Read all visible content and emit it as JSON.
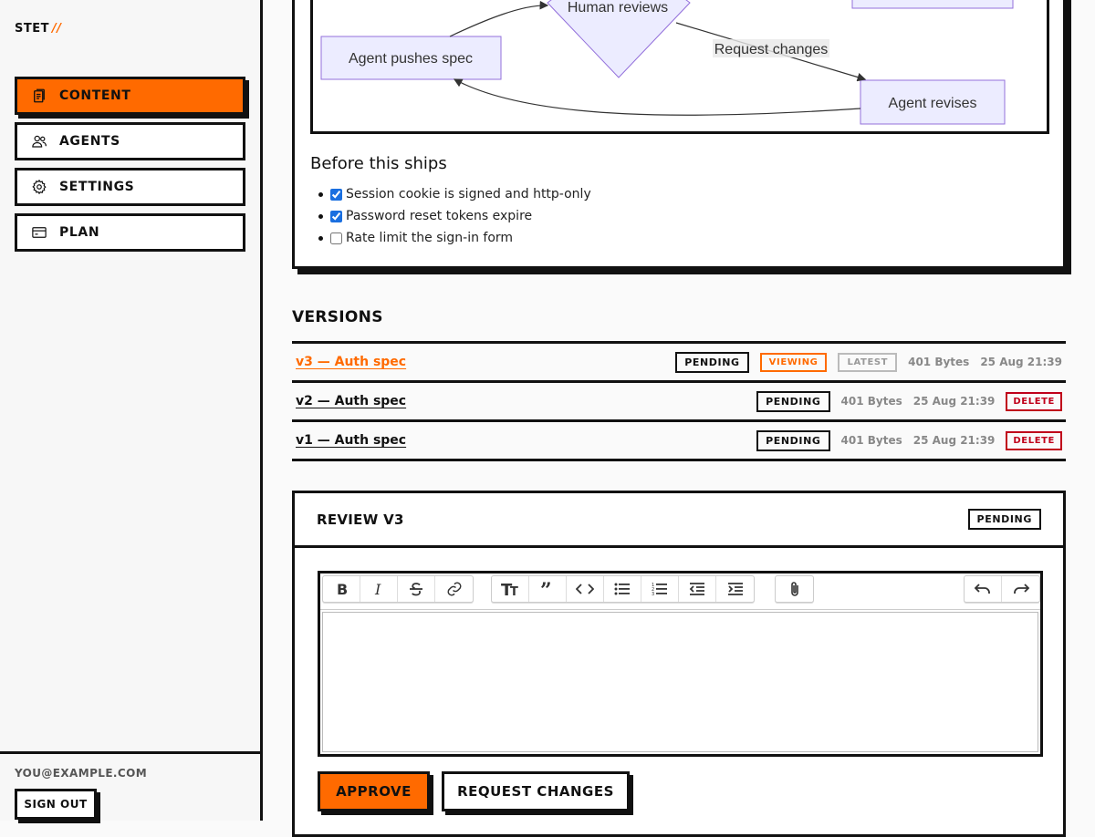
{
  "sidebar": {
    "brand": "STET",
    "brand_mark": "//",
    "nav": [
      {
        "label": "CONTENT",
        "icon": "clipboard-icon",
        "active": true
      },
      {
        "label": "AGENTS",
        "icon": "users-icon",
        "active": false
      },
      {
        "label": "SETTINGS",
        "icon": "gear-icon",
        "active": false
      },
      {
        "label": "PLAN",
        "icon": "credit-card-icon",
        "active": false
      }
    ],
    "user_email": "YOU@EXAMPLE.COM",
    "sign_out": "SIGN OUT"
  },
  "diagram": {
    "nodes": [
      "Human reviews",
      "Agent pushes spec",
      "Agent revises"
    ],
    "edge_label": "Request changes"
  },
  "checklist": {
    "title": "Before this ships",
    "items": [
      {
        "label": "Session cookie is signed and http-only",
        "checked": true
      },
      {
        "label": "Password reset tokens expire",
        "checked": true
      },
      {
        "label": "Rate limit the sign-in form",
        "checked": false
      }
    ]
  },
  "versions": {
    "title": "VERSIONS",
    "rows": [
      {
        "name": "v3 — Auth spec",
        "status": "PENDING",
        "viewing": "VIEWING",
        "latest": "LATEST",
        "size": "401 Bytes",
        "date": "25 Aug 21:39"
      },
      {
        "name": "v2 — Auth spec",
        "status": "PENDING",
        "size": "401 Bytes",
        "date": "25 Aug 21:39",
        "delete": "DELETE"
      },
      {
        "name": "v1 — Auth spec",
        "status": "PENDING",
        "size": "401 Bytes",
        "date": "25 Aug 21:39",
        "delete": "DELETE"
      }
    ]
  },
  "review": {
    "title": "REVIEW V3",
    "status": "PENDING",
    "approve": "APPROVE",
    "request_changes": "REQUEST CHANGES"
  },
  "colors": {
    "accent": "#ff6a00",
    "danger": "#c0001a",
    "node_fill": "#ececff",
    "node_stroke": "#9370db"
  }
}
